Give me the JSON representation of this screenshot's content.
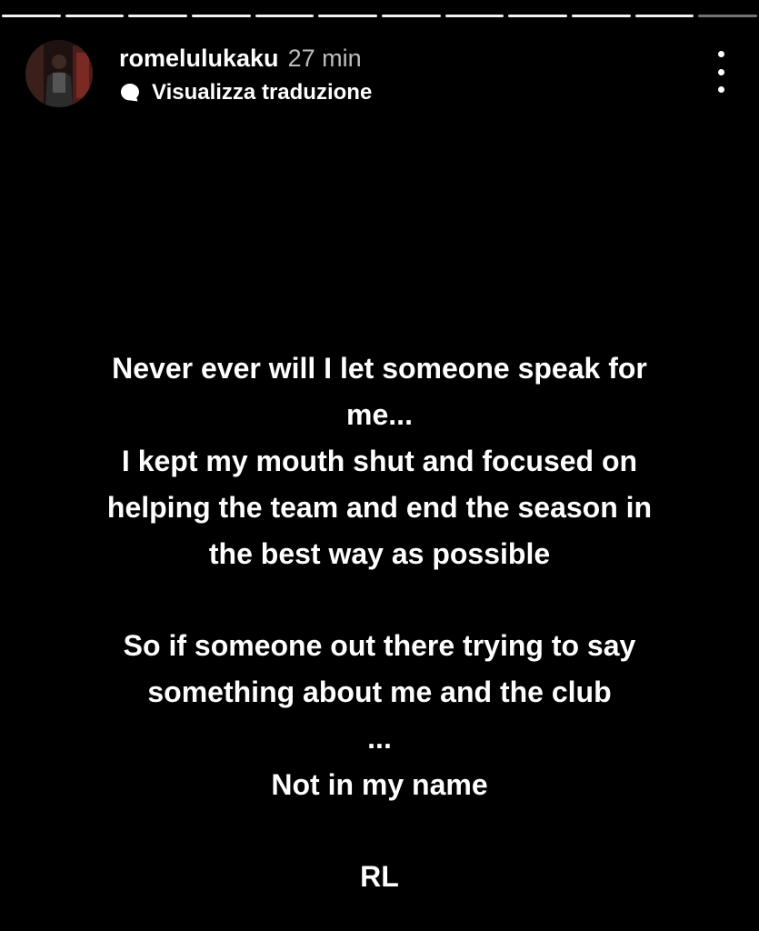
{
  "story": {
    "progress_segments": 12,
    "active_segment": 12,
    "username": "romelulukaku",
    "time": "27 min",
    "translate_label": "Visualizza traduzione",
    "message": {
      "paragraph1": [
        "Never ever will I let someone speak for",
        "me...",
        "I kept my mouth shut and focused on",
        "helping the team and end the season in",
        "the best way as possible"
      ],
      "paragraph2": [
        "So if someone out there trying to say",
        "something about me and the club",
        "...",
        "Not in my name"
      ],
      "signature": "RL"
    }
  },
  "icons": {
    "more": "more-vertical-icon",
    "translate": "translate-bubble-icon"
  },
  "colors": {
    "background": "#000000",
    "text": "#ffffff",
    "time_text": "#bdbdbd"
  }
}
